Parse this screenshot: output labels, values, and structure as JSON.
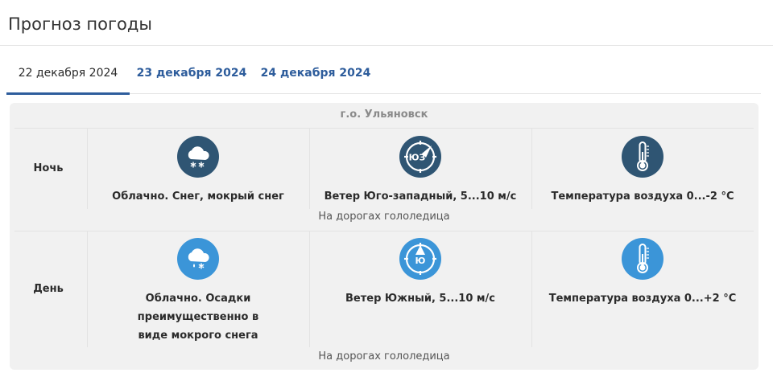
{
  "header": {
    "title": "Прогноз погоды"
  },
  "tabs": [
    {
      "label": "22 декабря 2024",
      "active": true
    },
    {
      "label": "23 декабря 2024",
      "active": false
    },
    {
      "label": "24 декабря 2024",
      "active": false
    }
  ],
  "forecast": {
    "city": "г.о. Ульяновск",
    "colors": {
      "night_icon": "#2f5573",
      "day_icon": "#3b95d8",
      "link": "#2e5d9c"
    },
    "periods": [
      {
        "label": "Ночь",
        "weather": {
          "text": "Облачно. Снег, мокрый снег",
          "icon": "cloud-snow-icon"
        },
        "wind": {
          "text": "Ветер Юго-западный, 5...10 м/с",
          "icon": "compass-icon",
          "badge": "ЮЗ"
        },
        "temperature": {
          "text": "Температура воздуха 0...-2 °C",
          "icon": "thermometer-icon"
        },
        "road_note": "На дорогах гололедица"
      },
      {
        "label": "День",
        "weather": {
          "text": "Облачно. Осадки преимущественно в виде мокрого снега",
          "icon": "cloud-sleet-icon"
        },
        "wind": {
          "text": "Ветер Южный, 5...10 м/с",
          "icon": "compass-icon",
          "badge": "Ю"
        },
        "temperature": {
          "text": "Температура воздуха 0...+2 °C",
          "icon": "thermometer-icon"
        },
        "road_note": "На дорогах гололедица"
      }
    ]
  }
}
